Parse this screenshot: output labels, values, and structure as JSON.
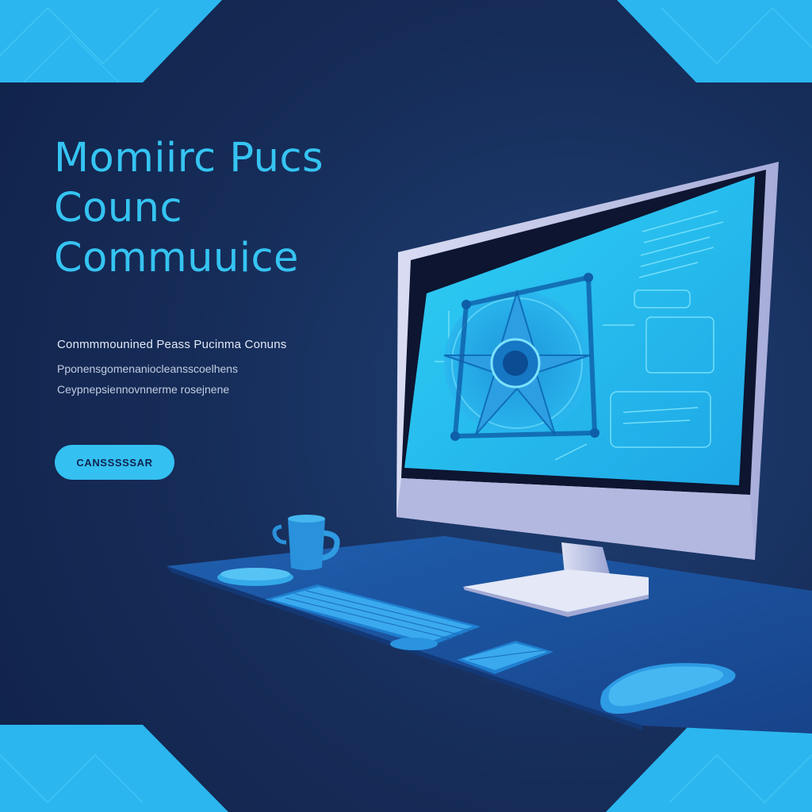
{
  "hero": {
    "headline_lines": [
      "Momiirc Pucs",
      "Counc",
      "Commuuice"
    ],
    "subtitle_lines": [
      "Conmmmounined Peass Pucinma Conuns",
      "Pponensgomenaniocleansscoelhens",
      "Ceypnepsiennovnnerme rosejnene"
    ],
    "cta_label": "CANSSSSSAR"
  },
  "colors": {
    "background": "#162c58",
    "accent": "#35c4f2",
    "accent_dark": "#1fa3df",
    "monitor_frame": "#b9bfe3",
    "desk": "#1f5aa8"
  },
  "icons": [
    "coffee-mug-icon",
    "computer-mouse-icon",
    "keyboard-icon",
    "fan-icon"
  ]
}
